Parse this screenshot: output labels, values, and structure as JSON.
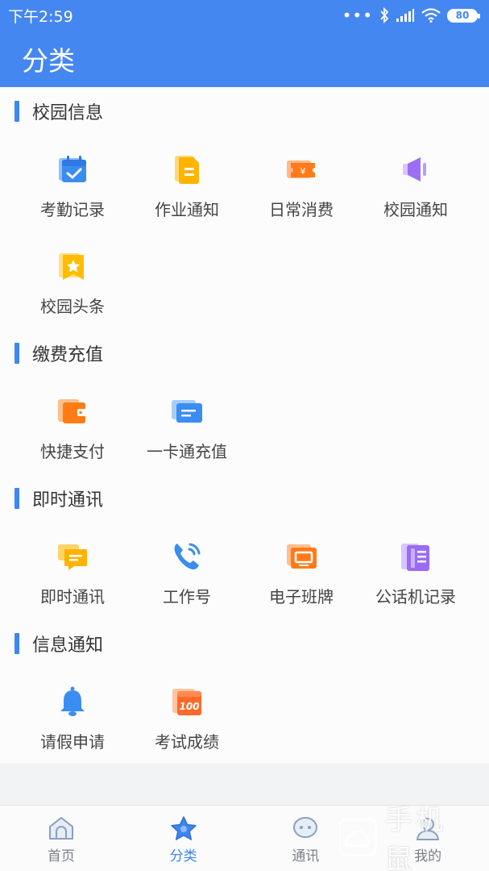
{
  "status": {
    "time": "下午2:59",
    "battery": "80"
  },
  "header": {
    "title": "分类"
  },
  "sections": [
    {
      "title": "校园信息",
      "items": [
        {
          "label": "考勤记录",
          "icon": "calendar-check-icon"
        },
        {
          "label": "作业通知",
          "icon": "document-icon"
        },
        {
          "label": "日常消费",
          "icon": "yuan-ticket-icon"
        },
        {
          "label": "校园通知",
          "icon": "speaker-icon"
        },
        {
          "label": "校园头条",
          "icon": "star-bookmark-icon"
        }
      ]
    },
    {
      "title": "缴费充值",
      "items": [
        {
          "label": "快捷支付",
          "icon": "wallet-icon"
        },
        {
          "label": "一卡通充值",
          "icon": "card-icon"
        }
      ]
    },
    {
      "title": "即时通讯",
      "items": [
        {
          "label": "即时通讯",
          "icon": "chat-bubble-icon"
        },
        {
          "label": "工作号",
          "icon": "phone-icon"
        },
        {
          "label": "电子班牌",
          "icon": "display-board-icon"
        },
        {
          "label": "公话机记录",
          "icon": "phone-record-icon"
        }
      ]
    },
    {
      "title": "信息通知",
      "items": [
        {
          "label": "请假申请",
          "icon": "bell-icon"
        },
        {
          "label": "考试成绩",
          "icon": "score-100-icon"
        }
      ]
    }
  ],
  "tabs": [
    {
      "label": "首页",
      "icon": "home-icon",
      "active": false
    },
    {
      "label": "分类",
      "icon": "star-icon",
      "active": true
    },
    {
      "label": "通讯",
      "icon": "chat-icon",
      "active": false
    },
    {
      "label": "我的",
      "icon": "user-icon",
      "active": false
    }
  ],
  "watermark": {
    "text": "手机鼠"
  },
  "colors": {
    "primary": "#4587f0",
    "accent": "#3d86f3"
  }
}
